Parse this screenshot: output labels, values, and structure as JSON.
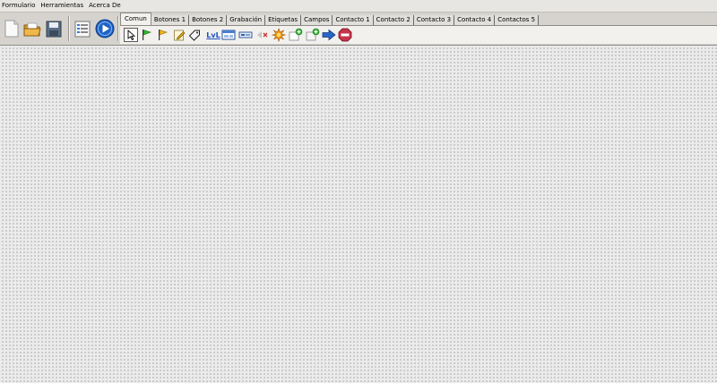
{
  "menu": {
    "items": [
      "Formulario",
      "Herramientas",
      "Acerca De"
    ]
  },
  "tabs": {
    "items": [
      "Comun",
      "Botones 1",
      "Botones 2",
      "Grabación",
      "Etiquetas",
      "Campos",
      "Contacto 1",
      "Contacto 2",
      "Contacto 3",
      "Contacto 4",
      "Contactos 5"
    ],
    "active": "Comun"
  },
  "tools": {
    "label_tool_text": "LvL",
    "icons": [
      "pointer-icon",
      "green-flag-icon",
      "yellow-flag-icon",
      "edit-note-icon",
      "tag-icon",
      "label-lvl-icon",
      "grid-box-icon",
      "field-box-icon",
      "disabled-arrow-icon",
      "burst-icon",
      "add-doc-icon",
      "add-doc-green-icon",
      "arrow-right-icon",
      "stop-record-icon"
    ]
  },
  "colors": {
    "canvas_bg": "#ebebeb",
    "toolbar_bg": "#d6d3ce",
    "accent_blue": "#1e63c6"
  }
}
